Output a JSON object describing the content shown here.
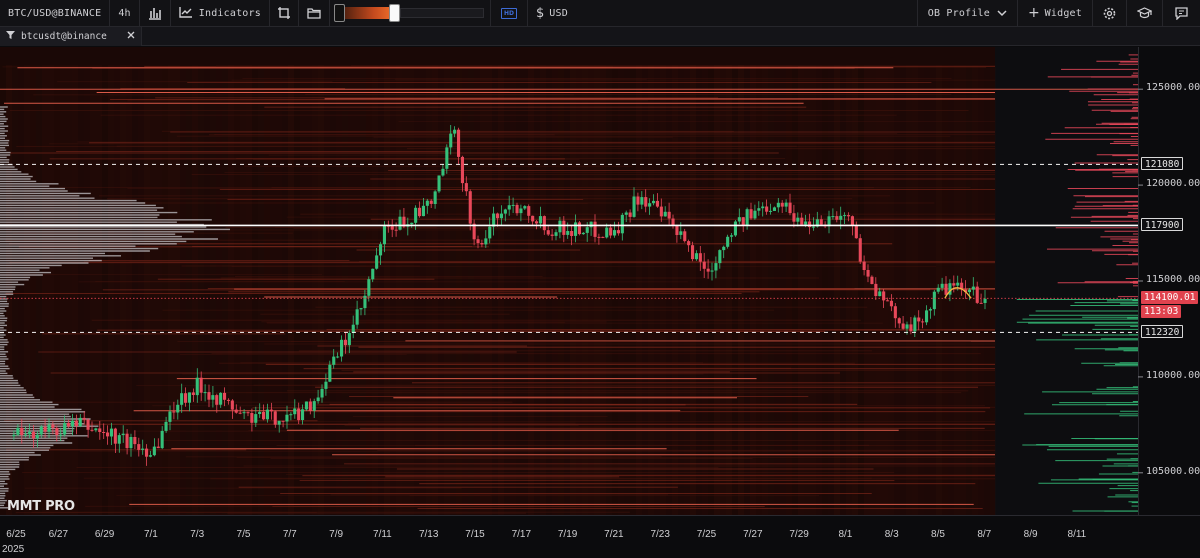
{
  "toolbar": {
    "symbol": "BTC/USD@BINANCE",
    "timeframe": "4h",
    "indicators_label": "Indicators",
    "hd_label": "HD",
    "currency_label": "USD",
    "profile_label": "OB Profile",
    "widget_label": "Widget",
    "heatmap_gradient_fill": 0.42,
    "icons": [
      "bar-chart-icon",
      "indicators-icon",
      "crop-icon",
      "folder-icon",
      "dollar-icon",
      "chevron-down-icon",
      "plus-icon",
      "gear-icon",
      "graduation-cap-icon",
      "chat-icon"
    ]
  },
  "tab": {
    "label": "btcusdt@binance",
    "icons": [
      "filter-icon",
      "close-icon"
    ]
  },
  "watermark": "MMT PRO",
  "chart_data": {
    "type": "candlestick-heatmap",
    "symbol": "BTC/USD",
    "interval": "4h",
    "year_label": "2025",
    "x_tick_labels": [
      "6/25",
      "6/27",
      "6/29",
      "7/1",
      "7/3",
      "7/5",
      "7/7",
      "7/9",
      "7/11",
      "7/13",
      "7/15",
      "7/17",
      "7/19",
      "7/21",
      "7/23",
      "7/25",
      "7/27",
      "7/29",
      "8/1",
      "8/3",
      "8/5",
      "8/7",
      "8/9",
      "8/11"
    ],
    "y_tick_labels": [
      "125000.00",
      "120000.00",
      "115000.00",
      "110000.00",
      "105000.00"
    ],
    "y_range": [
      102800,
      127200
    ],
    "level_lines": [
      {
        "label": "121080",
        "value": 121080,
        "style": "dashed"
      },
      {
        "label": "117900",
        "value": 117900,
        "style": "solid"
      },
      {
        "label": "112320",
        "value": 112320,
        "style": "dashed"
      }
    ],
    "current_price": {
      "label": "114100.01",
      "value": 114100.01,
      "countdown": "113:03"
    },
    "colors": {
      "up": "#35c07a",
      "down": "#e8485a",
      "level": "#ffffff",
      "current": "#e0424e",
      "heat_low": "#1a0806",
      "heat_high": "#ff5a3c",
      "volume_profile": "#cfcfd4"
    },
    "price_path": [
      {
        "date": "6/25",
        "price": 106900
      },
      {
        "date": "6/28",
        "price": 107500
      },
      {
        "date": "7/1",
        "price": 106100
      },
      {
        "date": "7/2",
        "price": 108700
      },
      {
        "date": "7/3",
        "price": 109600
      },
      {
        "date": "7/5",
        "price": 107900
      },
      {
        "date": "7/7",
        "price": 107900
      },
      {
        "date": "7/8",
        "price": 108800
      },
      {
        "date": "7/9",
        "price": 111200
      },
      {
        "date": "7/10",
        "price": 113500
      },
      {
        "date": "7/11",
        "price": 117500
      },
      {
        "date": "7/13",
        "price": 118900
      },
      {
        "date": "7/14",
        "price": 122800
      },
      {
        "date": "7/15",
        "price": 116600
      },
      {
        "date": "7/16",
        "price": 118700
      },
      {
        "date": "7/17",
        "price": 119000
      },
      {
        "date": "7/18",
        "price": 117800
      },
      {
        "date": "7/21",
        "price": 117600
      },
      {
        "date": "7/22",
        "price": 119500
      },
      {
        "date": "7/23",
        "price": 118400
      },
      {
        "date": "7/25",
        "price": 115500
      },
      {
        "date": "7/26",
        "price": 117800
      },
      {
        "date": "7/28",
        "price": 119300
      },
      {
        "date": "7/29",
        "price": 118000
      },
      {
        "date": "7/31",
        "price": 118500
      },
      {
        "date": "8/1",
        "price": 114800
      },
      {
        "date": "8/2",
        "price": 113200
      },
      {
        "date": "8/3",
        "price": 112600
      },
      {
        "date": "8/4",
        "price": 114600
      },
      {
        "date": "8/5",
        "price": 114500
      },
      {
        "date": "8/6",
        "price": 114100
      }
    ]
  }
}
